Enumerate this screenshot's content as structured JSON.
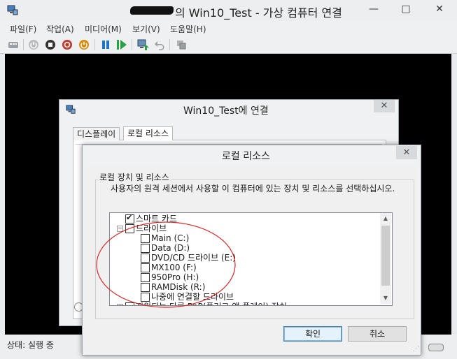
{
  "outer_window": {
    "title": "의 Win10_Test - 가상 컴퓨터 연결",
    "controls": {
      "minimize": "—",
      "maximize": "□",
      "close": "✕"
    }
  },
  "menu": [
    "파일(F)",
    "작업(A)",
    "미디어(M)",
    "보기(V)",
    "도움말(H)"
  ],
  "toolbar": {
    "icons": [
      "ctrl-alt-del-icon",
      "start-icon",
      "turn-off-icon",
      "shut-down-icon",
      "save-icon",
      "pause-icon",
      "resume-icon",
      "checkpoint-icon",
      "revert-icon",
      "enhanced-session-icon"
    ],
    "colors": {
      "shutdown_red": "#c0392b",
      "save_orange": "#d98a00",
      "pause_blue": "#1f73c7",
      "resume_green": "#2ea043"
    }
  },
  "status": {
    "text": "상태: 실행 중"
  },
  "connect_dialog": {
    "title": "Win10_Test에 연결",
    "tabs": [
      "디스플레이",
      "로컬 리소스"
    ],
    "active_tab": "로컬 리소스"
  },
  "resources_dialog": {
    "title": "로컬 리소스",
    "group_label": "로컬 장치 및 리소스",
    "description": "사용자의 원격 세션에서 사용할 이 컴퓨터에 있는 장치 및 리소스를 선택하십시오.",
    "tree": [
      {
        "label": "스마트 카드",
        "checked": true,
        "level": 0
      },
      {
        "label": "드라이브",
        "checked": false,
        "level": 0,
        "expander": "−"
      },
      {
        "label": "Main (C:)",
        "checked": false,
        "level": 1
      },
      {
        "label": "Data (D:)",
        "checked": false,
        "level": 1
      },
      {
        "label": "DVD/CD 드라이브 (E:)",
        "checked": false,
        "level": 1
      },
      {
        "label": "MX100 (F:)",
        "checked": false,
        "level": 1
      },
      {
        "label": "950Pro (H:)",
        "checked": false,
        "level": 1
      },
      {
        "label": "RAMDisk (R:)",
        "checked": false,
        "level": 1
      },
      {
        "label": "나중에 연결할 드라이브",
        "checked": false,
        "level": 1
      },
      {
        "label": "지원되는 다른 PnP(플러그 앤 플레이) 장치",
        "checked": false,
        "level": 0,
        "expander": "+"
      }
    ],
    "ok_label": "확인",
    "cancel_label": "취소"
  },
  "annotation_color": "#d62828"
}
